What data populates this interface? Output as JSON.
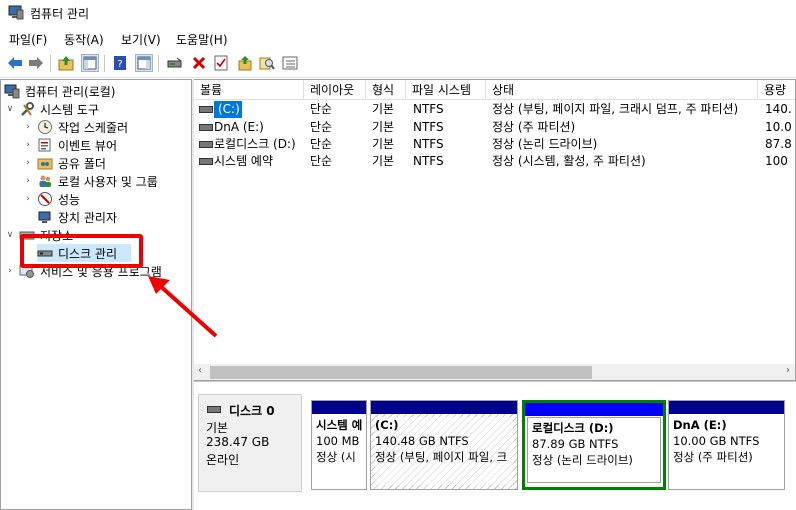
{
  "window": {
    "title": "컴퓨터 관리"
  },
  "menu": [
    "파일(F)",
    "동작(A)",
    "보기(V)",
    "도움말(H)"
  ],
  "tree": {
    "root": "컴퓨터 관리(로컬)",
    "system_tools": "시스템 도구",
    "task_scheduler": "작업 스케줄러",
    "event_viewer": "이벤트 뷰어",
    "shared_folders": "공유 폴더",
    "local_users": "로컬 사용자 및 그룹",
    "performance": "성능",
    "device_manager": "장치 관리자",
    "storage": "저장소",
    "disk_management": "디스크 관리",
    "services_apps": "서비스 및 응용 프로그램"
  },
  "columns": [
    "볼륨",
    "레이아웃",
    "형식",
    "파일 시스템",
    "상태",
    "용량"
  ],
  "volumes": [
    {
      "name": "(C:)",
      "layout": "단순",
      "type": "기본",
      "fs": "NTFS",
      "status": "정상 (부팅, 페이지 파일, 크래시 덤프, 주 파티션)",
      "capacity": "140."
    },
    {
      "name": "DnA (E:)",
      "layout": "단순",
      "type": "기본",
      "fs": "NTFS",
      "status": "정상 (주 파티션)",
      "capacity": "10.0"
    },
    {
      "name": "로컬디스크 (D:)",
      "layout": "단순",
      "type": "기본",
      "fs": "NTFS",
      "status": "정상 (논리 드라이브)",
      "capacity": "87.8"
    },
    {
      "name": "시스템 예약",
      "layout": "단순",
      "type": "기본",
      "fs": "NTFS",
      "status": "정상 (시스템, 활성, 주 파티션)",
      "capacity": "100"
    }
  ],
  "disk": {
    "name": "디스크 0",
    "type": "기본",
    "size": "238.47 GB",
    "state": "온라인",
    "partitions": [
      {
        "name": "시스템 예",
        "size": "100 MB",
        "status": "정상 (시"
      },
      {
        "name": "(C:)",
        "size": "140.48 GB NTFS",
        "status": "정상 (부팅, 페이지 파일, 크"
      },
      {
        "name": "로컬디스크  (D:)",
        "size": "87.89 GB NTFS",
        "status": "정상 (논리 드라이브)"
      },
      {
        "name": "DnA  (E:)",
        "size": "10.00 GB NTFS",
        "status": "정상 (주 파티션)"
      }
    ]
  },
  "colors": {
    "highlight": "#e00000",
    "partition_bar_primary": "#00008b",
    "partition_bar_logical": "#0000ff",
    "partition_selected_border": "#008000",
    "selection_bg": "#cce8ff"
  }
}
